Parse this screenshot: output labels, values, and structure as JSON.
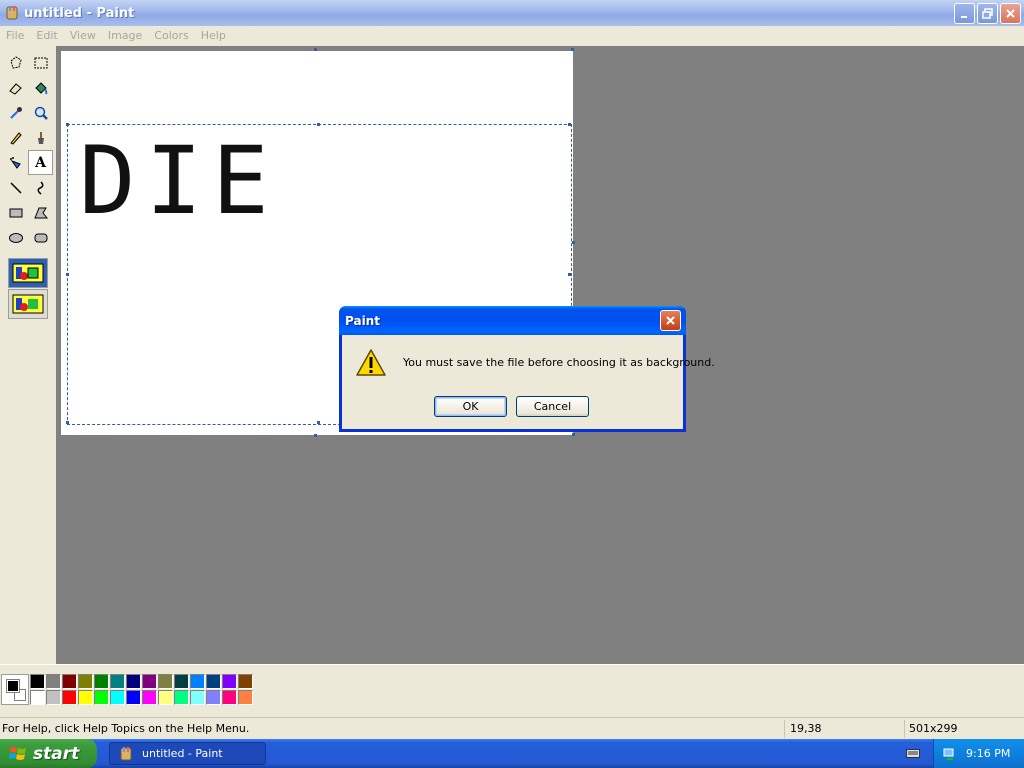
{
  "window": {
    "title": "untitled - Paint",
    "icon": "paint-icon",
    "controls": [
      "minimize-icon",
      "restore-icon",
      "close-icon"
    ]
  },
  "menu": {
    "items": [
      "File",
      "Edit",
      "View",
      "Image",
      "Colors",
      "Help"
    ]
  },
  "tools": {
    "items": [
      "free-form-select",
      "select",
      "eraser",
      "fill-with-color",
      "pick-color",
      "magnifier",
      "pencil",
      "brush",
      "airbrush",
      "text",
      "line",
      "curve",
      "rectangle",
      "polygon",
      "ellipse",
      "rounded-rectangle"
    ],
    "active": "text",
    "text_tool_glyph": "A",
    "options": [
      "opaque-background",
      "transparent-background"
    ],
    "selected_option": "opaque-background"
  },
  "canvas": {
    "text": "DIE"
  },
  "palette": {
    "foreground": "#000000",
    "background": "#ffffff",
    "colors_top": [
      "#000000",
      "#808080",
      "#800000",
      "#808000",
      "#008000",
      "#008080",
      "#000080",
      "#800080",
      "#808040",
      "#004040",
      "#0080ff",
      "#004080",
      "#8000ff",
      "#804000"
    ],
    "colors_bottom": [
      "#ffffff",
      "#c0c0c0",
      "#ff0000",
      "#ffff00",
      "#00ff00",
      "#00ffff",
      "#0000ff",
      "#ff00ff",
      "#ffff80",
      "#00ff80",
      "#80ffff",
      "#8080ff",
      "#ff0080",
      "#ff8040"
    ]
  },
  "status": {
    "help_text": "For Help, click Help Topics on the Help Menu.",
    "coords": "19,38",
    "size": "501x299"
  },
  "taskbar": {
    "start_label": "start",
    "task_label": "untitled - Paint",
    "clock": "9:16 PM"
  },
  "dialog": {
    "title": "Paint",
    "message": "You must save the file before choosing it as background.",
    "icon": "warning-icon",
    "ok_label": "OK",
    "cancel_label": "Cancel"
  }
}
